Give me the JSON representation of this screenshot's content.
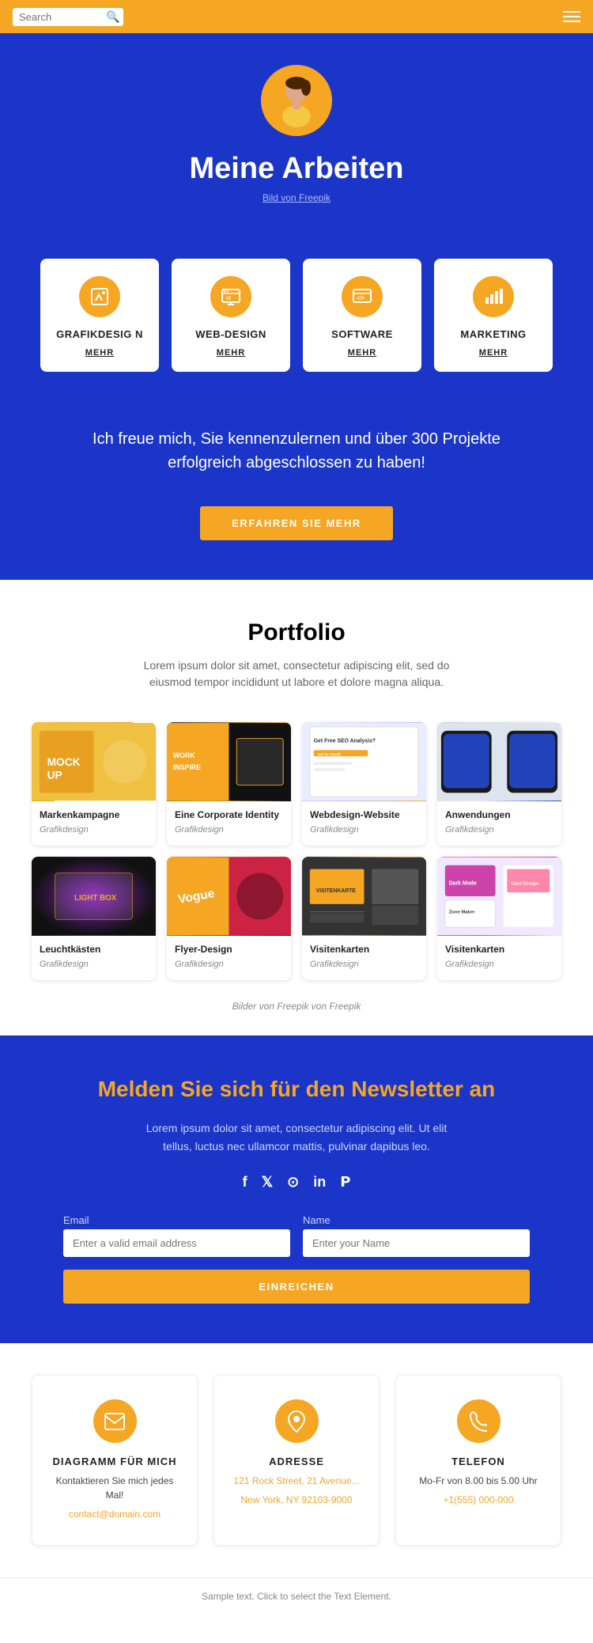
{
  "header": {
    "search_placeholder": "Search",
    "menu_label": "Menu"
  },
  "hero": {
    "title": "Meine Arbeiten",
    "credit_text": "Bild von Freepik"
  },
  "services": [
    {
      "id": "grafikdesign",
      "title": "GRAFIKDESIG N",
      "mehr": "MEHR",
      "icon": "🎨"
    },
    {
      "id": "webdesign",
      "title": "WEB-DESIGN",
      "mehr": "MEHR",
      "icon": "🖥"
    },
    {
      "id": "software",
      "title": "SOFTWARE",
      "mehr": "MEHR",
      "icon": "⚙"
    },
    {
      "id": "marketing",
      "title": "MARKETING",
      "mehr": "MEHR",
      "icon": "📊"
    }
  ],
  "tagline": {
    "text": "Ich freue mich, Sie kennenzulernen und über 300 Projekte erfolgreich abgeschlossen zu haben!",
    "cta_button": "ERFAHREN SIE MEHR"
  },
  "portfolio": {
    "title": "Portfolio",
    "description": "Lorem ipsum dolor sit amet, consectetur adipiscing elit, sed do eiusmod tempor incididunt ut labore et dolore magna aliqua.",
    "credit": "Bilder von Freepik",
    "items": [
      {
        "title": "Markenkampagne",
        "category": "Grafikdesign"
      },
      {
        "title": "Eine Corporate Identity",
        "category": "Grafikdesign"
      },
      {
        "title": "Webdesign-Website",
        "category": "Grafikdesign"
      },
      {
        "title": "Anwendungen",
        "category": "Grafikdesign"
      },
      {
        "title": "Leuchtkästen",
        "category": "Grafikdesign"
      },
      {
        "title": "Flyer-Design",
        "category": "Grafikdesign"
      },
      {
        "title": "Visitenkarten",
        "category": "Grafikdesign"
      },
      {
        "title": "Visitenkarten",
        "category": "Grafikdesign"
      }
    ]
  },
  "newsletter": {
    "title": "Melden Sie sich für den Newsletter an",
    "description": "Lorem ipsum dolor sit amet, consectetur adipiscing elit. Ut elit tellus, luctus nec ullamcor mattis, pulvinar dapibus leo.",
    "social": [
      "f",
      "𝕏",
      "in",
      "in",
      "𝗣"
    ],
    "email_label": "Email",
    "email_placeholder": "Enter a valid email address",
    "name_label": "Name",
    "name_placeholder": "Enter your Name",
    "submit_button": "EINREICHEN"
  },
  "contact": [
    {
      "id": "email",
      "title": "DIAGRAMM FÜR MICH",
      "subtitle": "Kontaktieren Sie mich jedes Mal!",
      "detail": "contact@domain.com",
      "icon": "✉"
    },
    {
      "id": "address",
      "title": "ADRESSE",
      "subtitle": "121 Rock Street, 21 Avenue...",
      "detail": "New York, NY 92103-9000",
      "icon": "📍"
    },
    {
      "id": "phone",
      "title": "TELEFON",
      "subtitle": "Mo-Fr von 8.00 bis 5.00 Uhr",
      "detail": "+1(555) 000-000",
      "icon": "📞"
    }
  ],
  "footer": {
    "text": "Sample text. Click to select the Text Element."
  }
}
